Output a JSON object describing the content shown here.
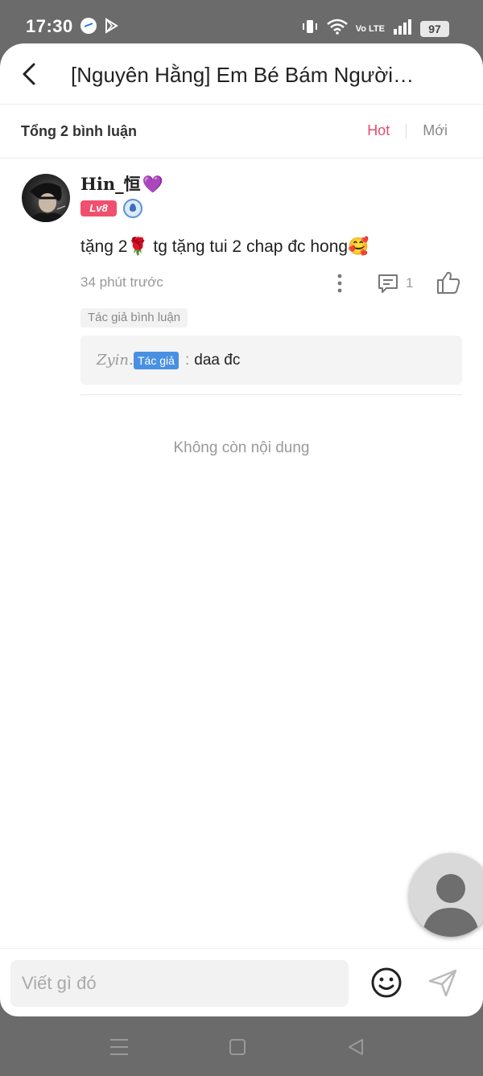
{
  "status_bar": {
    "time": "17:30",
    "battery": "97",
    "network": "Vo LTE",
    "icons": [
      "messenger-icon",
      "play-store-icon",
      "vibrate-icon",
      "wifi-icon",
      "volte-icon",
      "signal-icon",
      "battery-icon"
    ]
  },
  "header": {
    "title": "[Nguyên Hằng] Em Bé Bám Người Rồi",
    "back_icon": "chevron-left-icon"
  },
  "summary": {
    "total": "Tổng 2 bình luận",
    "sort_hot": "Hot",
    "sort_new": "Mới",
    "active_sort_color": "#e24d6a"
  },
  "comment": {
    "username": "Hin_恒",
    "heart": "💜",
    "level": "Lv8",
    "text": "tặng 2🌹 tg tặng tui 2 chap đc hong🥰",
    "time": "34 phút trước",
    "reply_count": "1",
    "author_tag": "Tác giả bình luận",
    "reply": {
      "name": "Zyin.",
      "badge": "Tác giả",
      "text": "daa đc"
    }
  },
  "end_text": "Không còn nội dung",
  "input": {
    "placeholder": "Viết gì đó"
  },
  "colors": {
    "level_badge": "#f0506e",
    "author_badge": "#4a90e2",
    "accent": "#e24d6a"
  }
}
